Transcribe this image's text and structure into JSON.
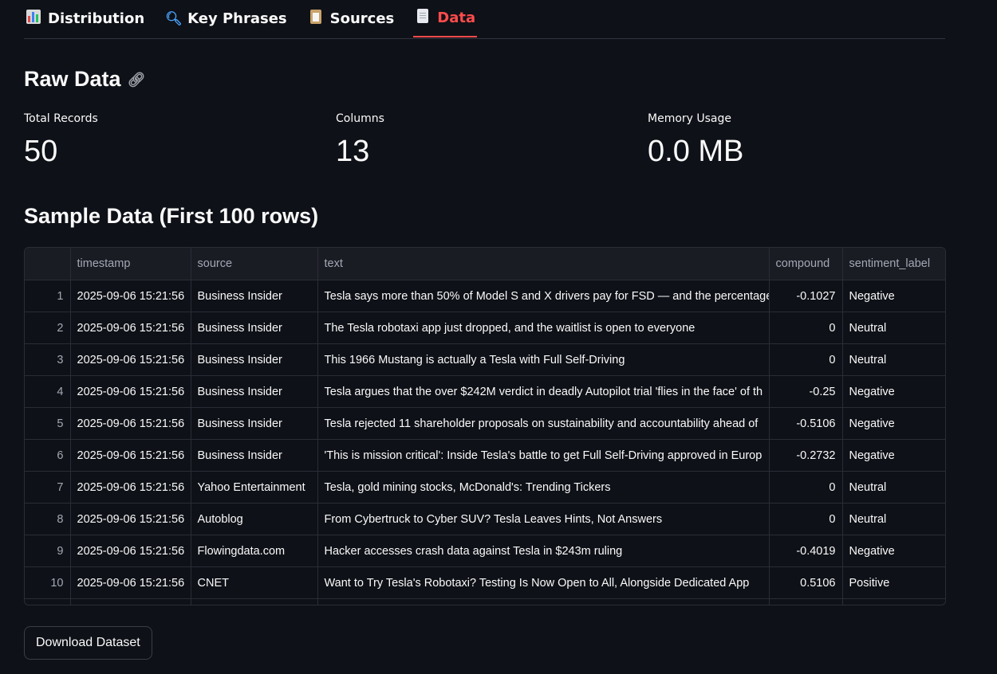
{
  "tabs": [
    {
      "label": "Distribution",
      "icon": "bar-chart-icon",
      "active": false
    },
    {
      "label": "Key Phrases",
      "icon": "magnifier-icon",
      "active": false
    },
    {
      "label": "Sources",
      "icon": "clipboard-icon",
      "active": false
    },
    {
      "label": "Data",
      "icon": "page-icon",
      "active": true
    }
  ],
  "raw_data": {
    "title": "Raw Data",
    "metrics": [
      {
        "label": "Total Records",
        "value": "50"
      },
      {
        "label": "Columns",
        "value": "13"
      },
      {
        "label": "Memory Usage",
        "value": "0.0 MB"
      }
    ]
  },
  "sample": {
    "title": "Sample Data (First 100 rows)",
    "columns": [
      "",
      "timestamp",
      "source",
      "text",
      "compound",
      "sentiment_label"
    ],
    "rows": [
      [
        "1",
        "2025-09-06 15:21:56",
        "Business Insider",
        "Tesla says more than 50% of Model S and X drivers pay for FSD — and the percentage",
        "-0.1027",
        "Negative"
      ],
      [
        "2",
        "2025-09-06 15:21:56",
        "Business Insider",
        "The Tesla robotaxi app just dropped, and the waitlist is open to everyone",
        "0",
        "Neutral"
      ],
      [
        "3",
        "2025-09-06 15:21:56",
        "Business Insider",
        "This 1966 Mustang is actually a Tesla with Full Self-Driving",
        "0",
        "Neutral"
      ],
      [
        "4",
        "2025-09-06 15:21:56",
        "Business Insider",
        "Tesla argues that the over $242M verdict in deadly Autopilot trial 'flies in the face' of th",
        "-0.25",
        "Negative"
      ],
      [
        "5",
        "2025-09-06 15:21:56",
        "Business Insider",
        "Tesla rejected 11 shareholder proposals on sustainability and accountability ahead of",
        "-0.5106",
        "Negative"
      ],
      [
        "6",
        "2025-09-06 15:21:56",
        "Business Insider",
        "'This is mission critical': Inside Tesla's battle to get Full Self-Driving approved in Europ",
        "-0.2732",
        "Negative"
      ],
      [
        "7",
        "2025-09-06 15:21:56",
        "Yahoo Entertainment",
        "Tesla, gold mining stocks, McDonald's: Trending Tickers",
        "0",
        "Neutral"
      ],
      [
        "8",
        "2025-09-06 15:21:56",
        "Autoblog",
        "From Cybertruck to Cyber SUV? Tesla Leaves Hints, Not Answers",
        "0",
        "Neutral"
      ],
      [
        "9",
        "2025-09-06 15:21:56",
        "Flowingdata.com",
        "Hacker accesses crash data against Tesla in $243m ruling",
        "-0.4019",
        "Negative"
      ],
      [
        "10",
        "2025-09-06 15:21:56",
        "CNET",
        "Want to Try Tesla's Robotaxi? Testing Is Now Open to All, Alongside Dedicated App",
        "0.5106",
        "Positive"
      ]
    ]
  },
  "download_label": "Download Dataset"
}
